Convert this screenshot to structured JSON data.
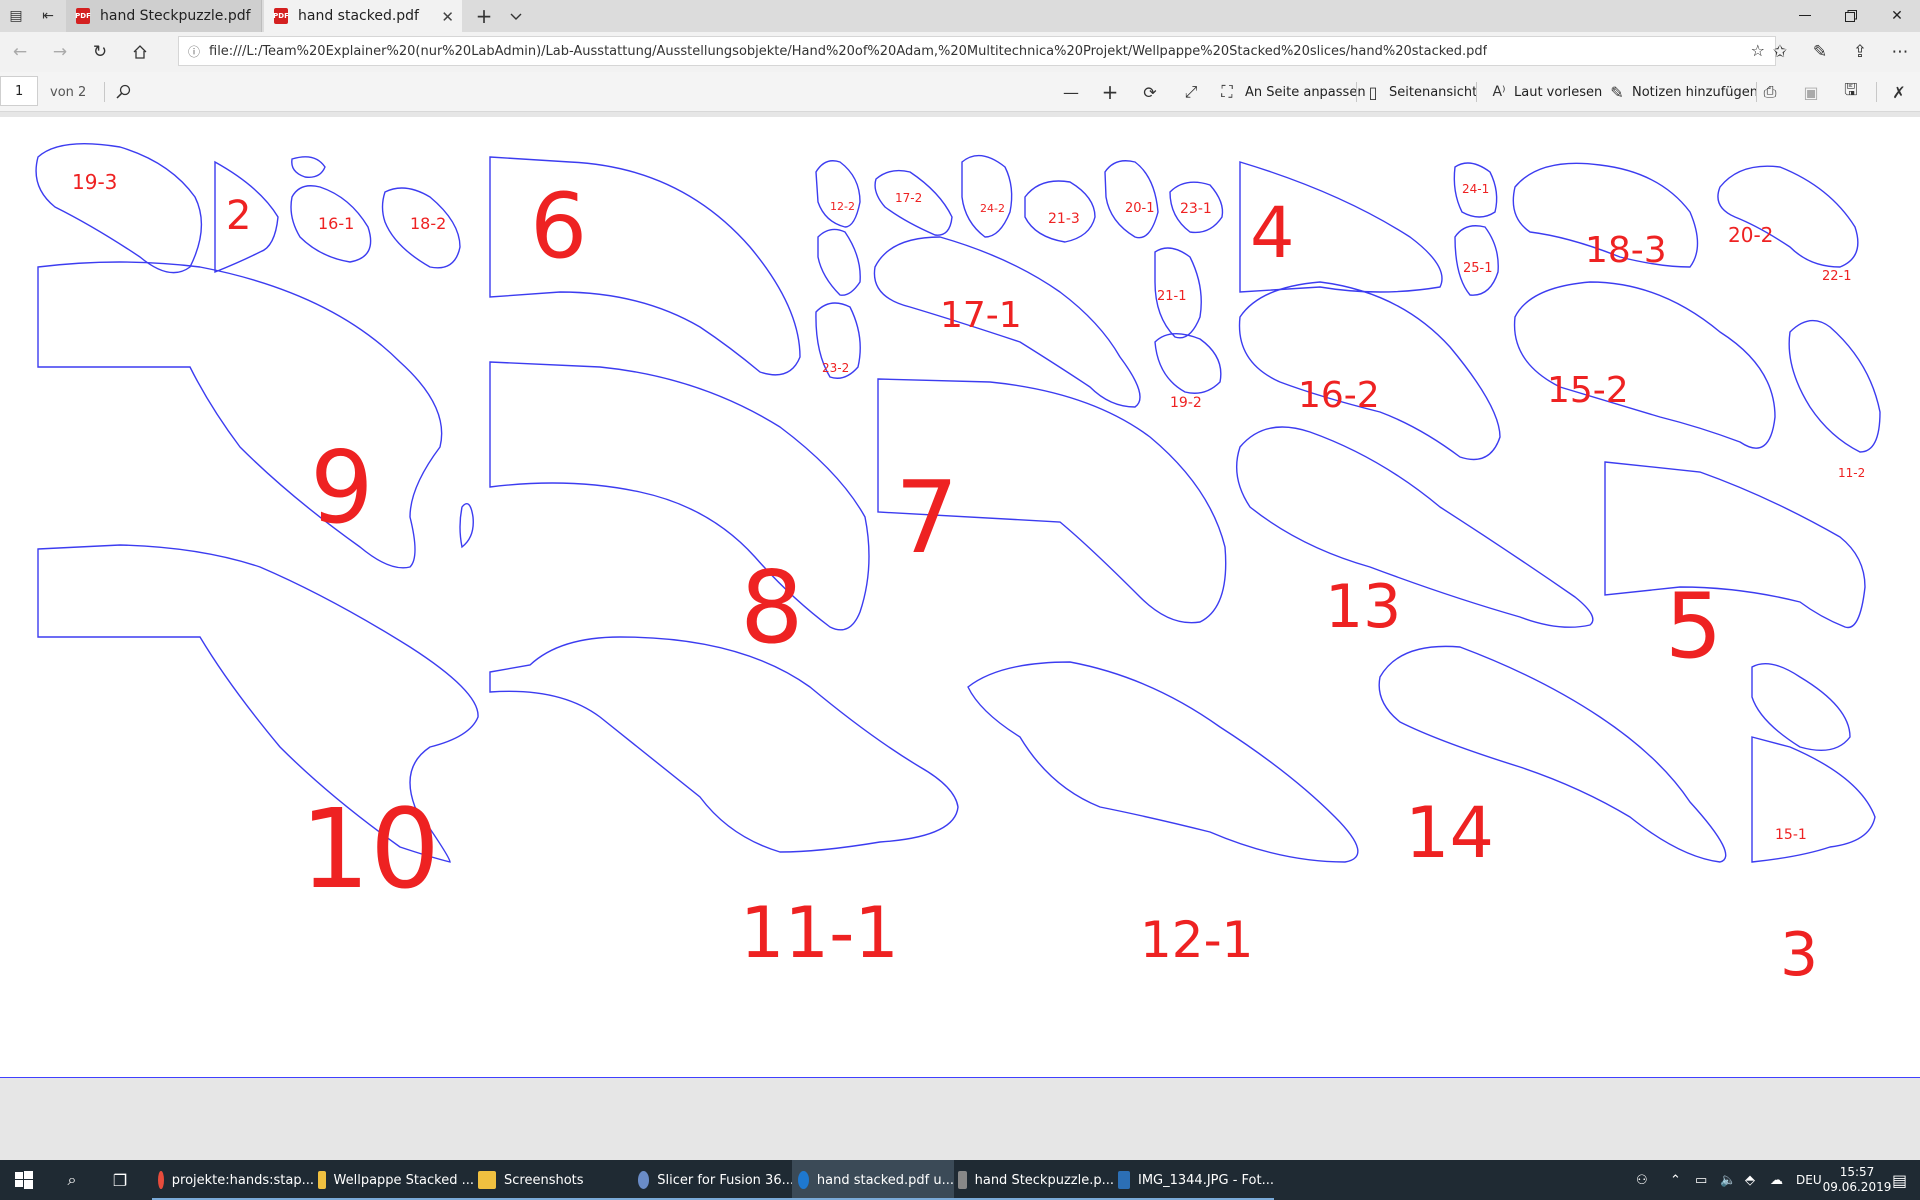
{
  "tabs": [
    {
      "title": "hand Steckpuzzle.pdf",
      "active": false
    },
    {
      "title": "hand stacked.pdf",
      "active": true
    }
  ],
  "address": {
    "url": "file:///L:/Team%20Explainer%20(nur%20LabAdmin)/Lab-Ausstattung/Ausstellungsobjekte/Hand%20of%20Adam,%20Multitechnica%20Projekt/Wellpappe%20Stacked%20slices/hand%20stacked.pdf"
  },
  "pdf_toolbar": {
    "page_current": "1",
    "page_total": "von 2",
    "fit_page": "An Seite anpassen",
    "page_view": "Seitenansicht",
    "read_aloud": "Laut vorlesen",
    "add_notes": "Notizen hinzufügen"
  },
  "document": {
    "piece_labels": [
      "19-3",
      "2",
      "16-1",
      "18-2",
      "6",
      "12-2",
      "17-2",
      "24-2",
      "21-3",
      "20-1",
      "23-1",
      "4",
      "24-1",
      "18-3",
      "20-2",
      "22-1",
      "17-1",
      "21-1",
      "25-1",
      "9",
      "23-2",
      "19-2",
      "16-2",
      "15-2",
      "11-2",
      "8",
      "7",
      "13",
      "5",
      "10",
      "11-1",
      "12-1",
      "14",
      "15-1",
      "3"
    ],
    "line_color": "#3c3cf0",
    "label_color": "#ee2222"
  },
  "taskbar": {
    "items": [
      {
        "label": "projekte:hands:stap...",
        "icon": "chrome-icon"
      },
      {
        "label": "Wellpappe Stacked ...",
        "icon": "folder-icon"
      },
      {
        "label": "Screenshots",
        "icon": "folder-icon"
      },
      {
        "label": "Slicer for Fusion 36...",
        "icon": "slicer-icon"
      },
      {
        "label": "hand stacked.pdf u...",
        "icon": "edge-icon"
      },
      {
        "label": "hand Steckpuzzle.p...",
        "icon": "app-icon"
      },
      {
        "label": "IMG_1344.JPG - Fot...",
        "icon": "photos-icon"
      }
    ],
    "language": "DEU",
    "time": "15:57",
    "date": "09.06.2019"
  }
}
